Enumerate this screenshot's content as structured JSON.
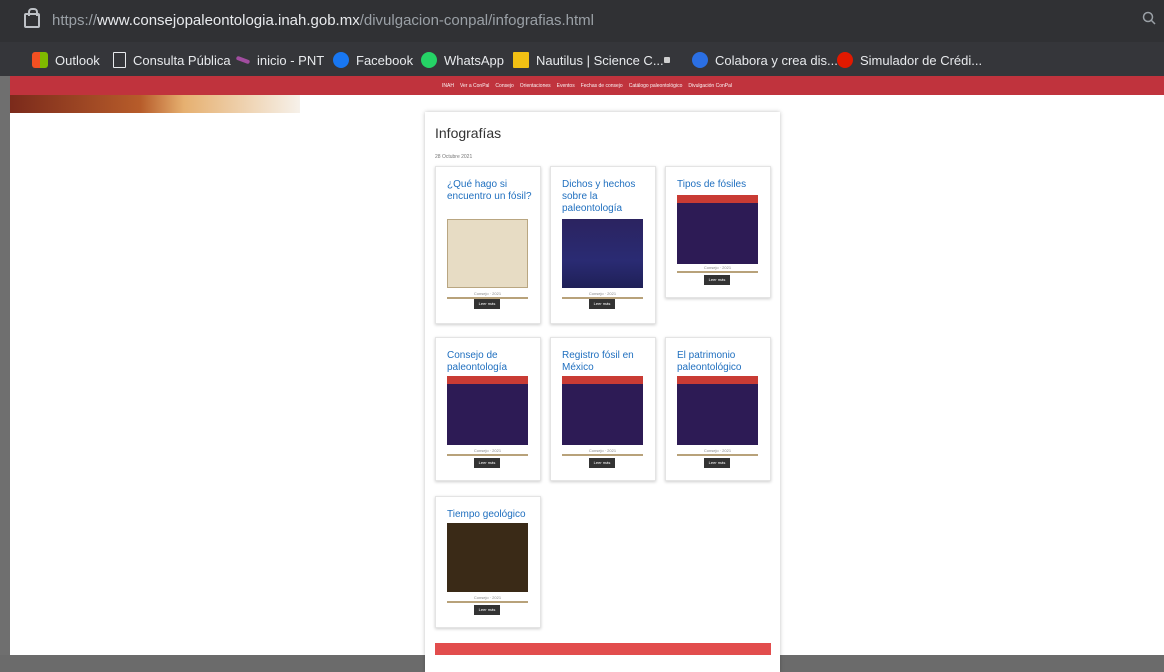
{
  "browser": {
    "url_prefix": "https://",
    "url_host": "www.consejopaleontologia.inah.gob.mx",
    "url_path": "/divulgacion-conpal/infografias.html",
    "bookmarks": [
      {
        "label": "Outlook",
        "icon": "microsoft-icon",
        "color": "#f25022"
      },
      {
        "label": "Consulta Pública",
        "icon": "document-icon",
        "color": "#ffffff"
      },
      {
        "label": "inicio - PNT",
        "icon": "pnt-icon",
        "color": "#a24da0"
      },
      {
        "label": "Facebook",
        "icon": "facebook-icon",
        "color": "#1877f2"
      },
      {
        "label": "WhatsApp",
        "icon": "whatsapp-icon",
        "color": "#25d366"
      },
      {
        "label": "Nautilus | Science C...",
        "icon": "nautilus-icon",
        "color": "#f2c014"
      },
      {
        "label": "",
        "icon": "grid-icon",
        "color": "#ffffff"
      },
      {
        "label": "Colabora y crea dis...",
        "icon": "canva-icon",
        "color": "#00c4cc"
      },
      {
        "label": "Simulador de Crédi...",
        "icon": "red-dot-icon",
        "color": "#e11900"
      }
    ]
  },
  "site": {
    "nav": [
      "INAH",
      "Ver a ConPal",
      "Consejo",
      "Orientaciones",
      "Eventos",
      "Fechas de consejo",
      "Catálogo paleontológico",
      "Divulgación ConPal"
    ],
    "page_title": "Infografías",
    "date": "28 Octubre 2021"
  },
  "items": [
    {
      "title": "¿Qué hago si encuentro un fósil?",
      "button": "Leer más",
      "meta": "Consejo · 2021",
      "img": "paper"
    },
    {
      "title": "Dichos y hechos sobre la paleontología",
      "button": "Leer más",
      "meta": "Consejo · 2021",
      "img": "purple"
    },
    {
      "title": "Tipos de fósiles",
      "button": "Leer más",
      "meta": "Consejo · 2021",
      "img": "purple-red"
    },
    {
      "title": "Consejo de paleontología",
      "button": "Leer más",
      "meta": "Consejo · 2021",
      "img": "purple-red"
    },
    {
      "title": "Registro fósil en México",
      "button": "Leer más",
      "meta": "Consejo · 2021",
      "img": "purple-red"
    },
    {
      "title": "El patrimonio paleontológico",
      "button": "Leer más",
      "meta": "Consejo · 2021",
      "img": "purple-red"
    },
    {
      "title": "Tiempo geológico",
      "button": "Leer más",
      "meta": "Consejo · 2021",
      "img": "brown"
    }
  ],
  "colors": {
    "link": "#1f6fbf",
    "nav": "#c0333d",
    "pager": "#e24d4d"
  }
}
